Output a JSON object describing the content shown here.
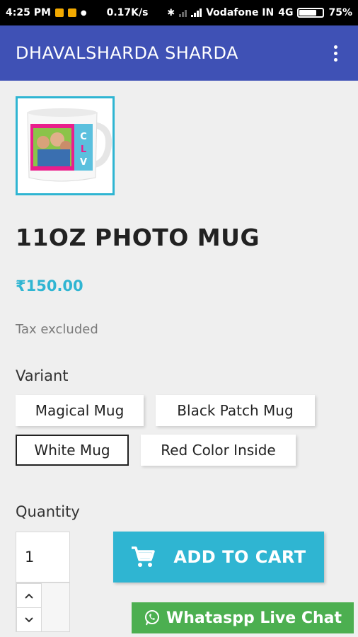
{
  "status_bar": {
    "time": "4:25 PM",
    "speed": "0.17K/s",
    "carrier": "Vodafone IN",
    "network": "4G",
    "battery_pct": "75%",
    "battery_level": 0.75
  },
  "app_bar": {
    "title": "DHAVALSHARDA SHARDA",
    "menu_icon": "more-vert-icon",
    "color": "#3f51b5"
  },
  "product": {
    "image_alt": "photo-mug-thumbnail",
    "name": "11OZ PHOTO MUG",
    "price": "₹150.00",
    "tax_note": "Tax excluded",
    "accent_color": "#2fb5d2"
  },
  "variants": {
    "label": "Variant",
    "options": [
      "Magical Mug",
      "Black Patch Mug",
      "White Mug",
      "Red Color Inside"
    ],
    "selected": "White Mug"
  },
  "quantity": {
    "label": "Quantity",
    "value": "1",
    "up_icon": "chevron-up-icon",
    "down_icon": "chevron-down-icon"
  },
  "cart_button": {
    "label": "ADD TO CART",
    "icon": "cart-icon"
  },
  "whatsapp": {
    "label": "Whataspp Live Chat",
    "icon": "whatsapp-icon",
    "color": "#4caf50"
  }
}
